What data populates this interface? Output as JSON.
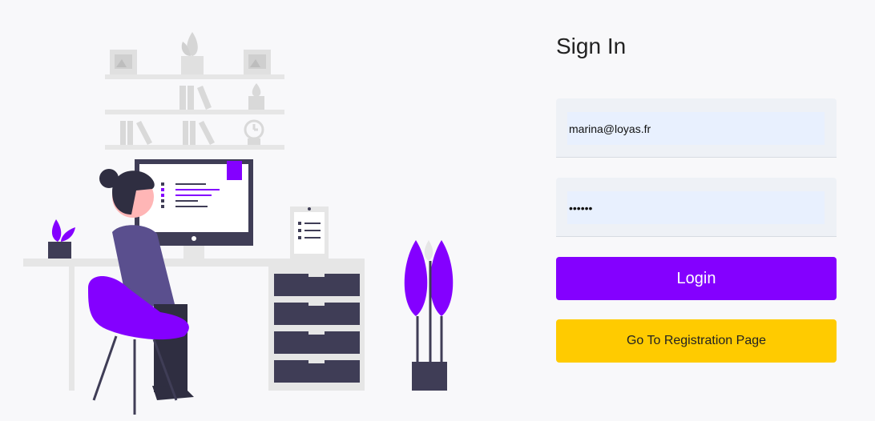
{
  "title": "Sign In",
  "email": {
    "value": "marina@loyas.fr"
  },
  "password": {
    "value": "••••••"
  },
  "login_label": "Login",
  "register_label": "Go To Registration Page",
  "colors": {
    "accent": "#8400ff",
    "secondary": "#ffcb00",
    "illustration_dark": "#3f3d56",
    "illustration_shelf": "#e6e6e6"
  }
}
